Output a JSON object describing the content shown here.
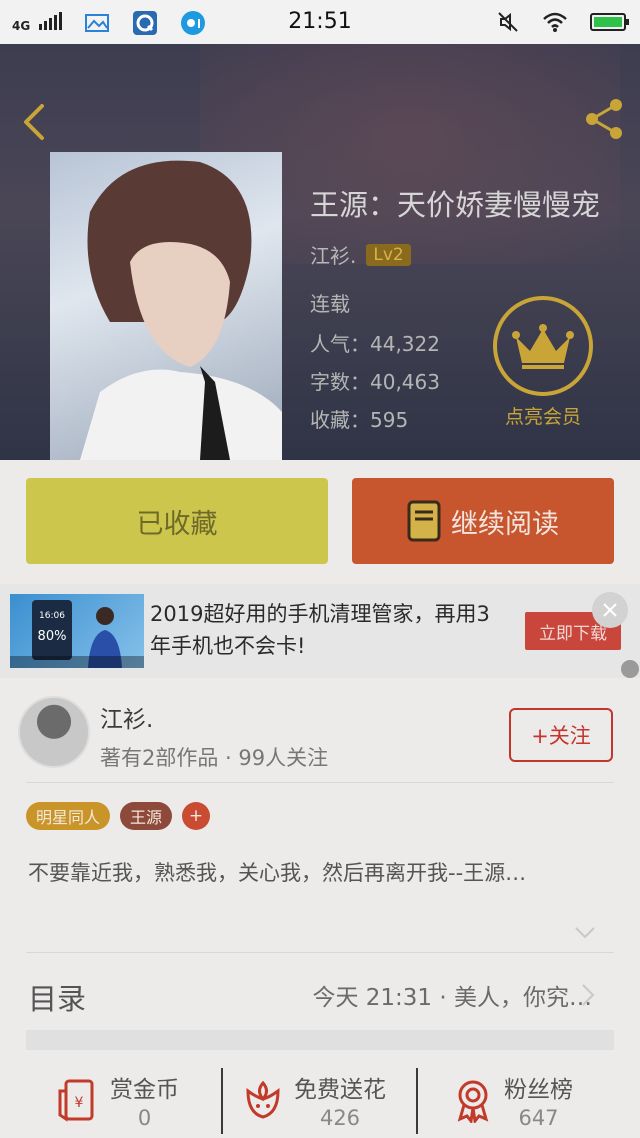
{
  "status_bar": {
    "network": "4G",
    "time": "21:51"
  },
  "book": {
    "title": "王源：天价娇妻慢慢宠",
    "author": "江衫.",
    "level": "Lv2",
    "status": "连载",
    "popularity": "人气：44,322",
    "word_count": "字数：40,463",
    "favorites": "收藏：595",
    "vip_label": "点亮会员"
  },
  "actions": {
    "collected": "已收藏",
    "continue": "继续阅读"
  },
  "ad": {
    "text": "2019超好用的手机清理管家，再用3年手机也不会卡!",
    "button": "立即下载",
    "img_time": "16:06",
    "img_pct": "80%"
  },
  "author_section": {
    "name": "江衫.",
    "stats": "著有2部作品 · 99人关注",
    "follow": "+关注"
  },
  "tags": [
    "明星同人",
    "王源",
    "+"
  ],
  "intro": "不要靠近我，熟悉我，关心我，然后再离开我--王源…",
  "toc": {
    "label": "目录",
    "latest": "今天 21:31 · 美人，你究…"
  },
  "bottom": {
    "reward": {
      "label": "赏金币",
      "value": "0"
    },
    "flowers": {
      "label": "免费送花",
      "value": "426"
    },
    "fans": {
      "label": "粉丝榜",
      "value": "647"
    }
  },
  "colors": {
    "accent_gold": "#c9a538",
    "accent_red": "#c4352c",
    "collect_yellow": "#cdc64d",
    "read_orange": "#c7552e"
  }
}
